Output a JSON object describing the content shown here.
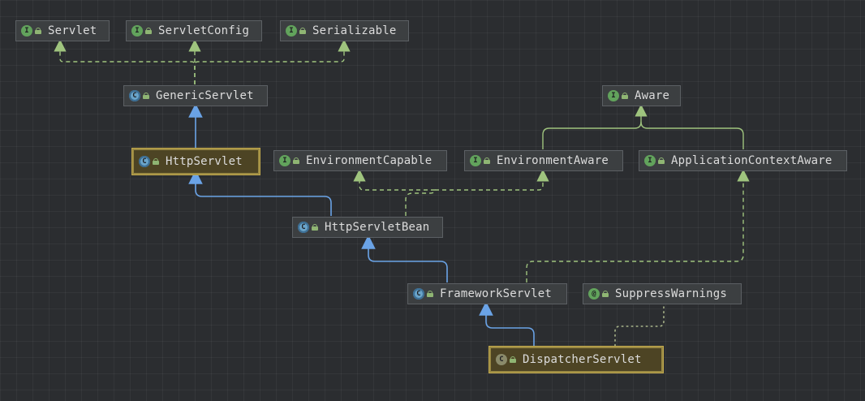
{
  "diagram": {
    "nodes": {
      "servlet": {
        "label": "Servlet",
        "kind": "interface",
        "kind_icon": "I"
      },
      "servlet_config": {
        "label": "ServletConfig",
        "kind": "interface",
        "kind_icon": "I"
      },
      "serializable": {
        "label": "Serializable",
        "kind": "interface",
        "kind_icon": "I"
      },
      "generic_servlet": {
        "label": "GenericServlet",
        "kind": "abstract-class",
        "kind_icon": "C"
      },
      "aware": {
        "label": "Aware",
        "kind": "interface",
        "kind_icon": "I"
      },
      "http_servlet": {
        "label": "HttpServlet",
        "kind": "abstract-class",
        "kind_icon": "C",
        "selected": true
      },
      "environment_capable": {
        "label": "EnvironmentCapable",
        "kind": "interface",
        "kind_icon": "I"
      },
      "environment_aware": {
        "label": "EnvironmentAware",
        "kind": "interface",
        "kind_icon": "I"
      },
      "application_context_aware": {
        "label": "ApplicationContextAware",
        "kind": "interface",
        "kind_icon": "I"
      },
      "http_servlet_bean": {
        "label": "HttpServletBean",
        "kind": "abstract-class",
        "kind_icon": "C"
      },
      "framework_servlet": {
        "label": "FrameworkServlet",
        "kind": "abstract-class",
        "kind_icon": "C"
      },
      "suppress_warnings": {
        "label": "SuppressWarnings",
        "kind": "annotation",
        "kind_icon": "@"
      },
      "dispatcher_servlet": {
        "label": "DispatcherServlet",
        "kind": "class",
        "kind_icon": "C",
        "selected": true
      }
    },
    "edges": [
      {
        "from": "generic_servlet",
        "to": "servlet",
        "type": "implements"
      },
      {
        "from": "generic_servlet",
        "to": "servlet_config",
        "type": "implements"
      },
      {
        "from": "generic_servlet",
        "to": "serializable",
        "type": "implements"
      },
      {
        "from": "http_servlet",
        "to": "generic_servlet",
        "type": "extends"
      },
      {
        "from": "environment_aware",
        "to": "aware",
        "type": "interface-extends"
      },
      {
        "from": "application_context_aware",
        "to": "aware",
        "type": "interface-extends"
      },
      {
        "from": "http_servlet_bean",
        "to": "http_servlet",
        "type": "extends"
      },
      {
        "from": "http_servlet_bean",
        "to": "environment_capable",
        "type": "implements"
      },
      {
        "from": "http_servlet_bean",
        "to": "environment_aware",
        "type": "implements"
      },
      {
        "from": "framework_servlet",
        "to": "http_servlet_bean",
        "type": "extends"
      },
      {
        "from": "framework_servlet",
        "to": "application_context_aware",
        "type": "implements"
      },
      {
        "from": "dispatcher_servlet",
        "to": "framework_servlet",
        "type": "extends"
      },
      {
        "from": "dispatcher_servlet",
        "to": "suppress_warnings",
        "type": "annotated-with"
      }
    ],
    "colors": {
      "background": "#2b2d30",
      "extends_edge": "#6aa3e6",
      "implements_edge": "#9fc47e",
      "annotation_edge": "#a8b48a",
      "node_fill": "#3c3f41",
      "selected_fill": "#4d4424",
      "selected_border": "#9b8a43",
      "interface_icon": "#62a35c",
      "class_icon": "#6aa4c9"
    }
  }
}
